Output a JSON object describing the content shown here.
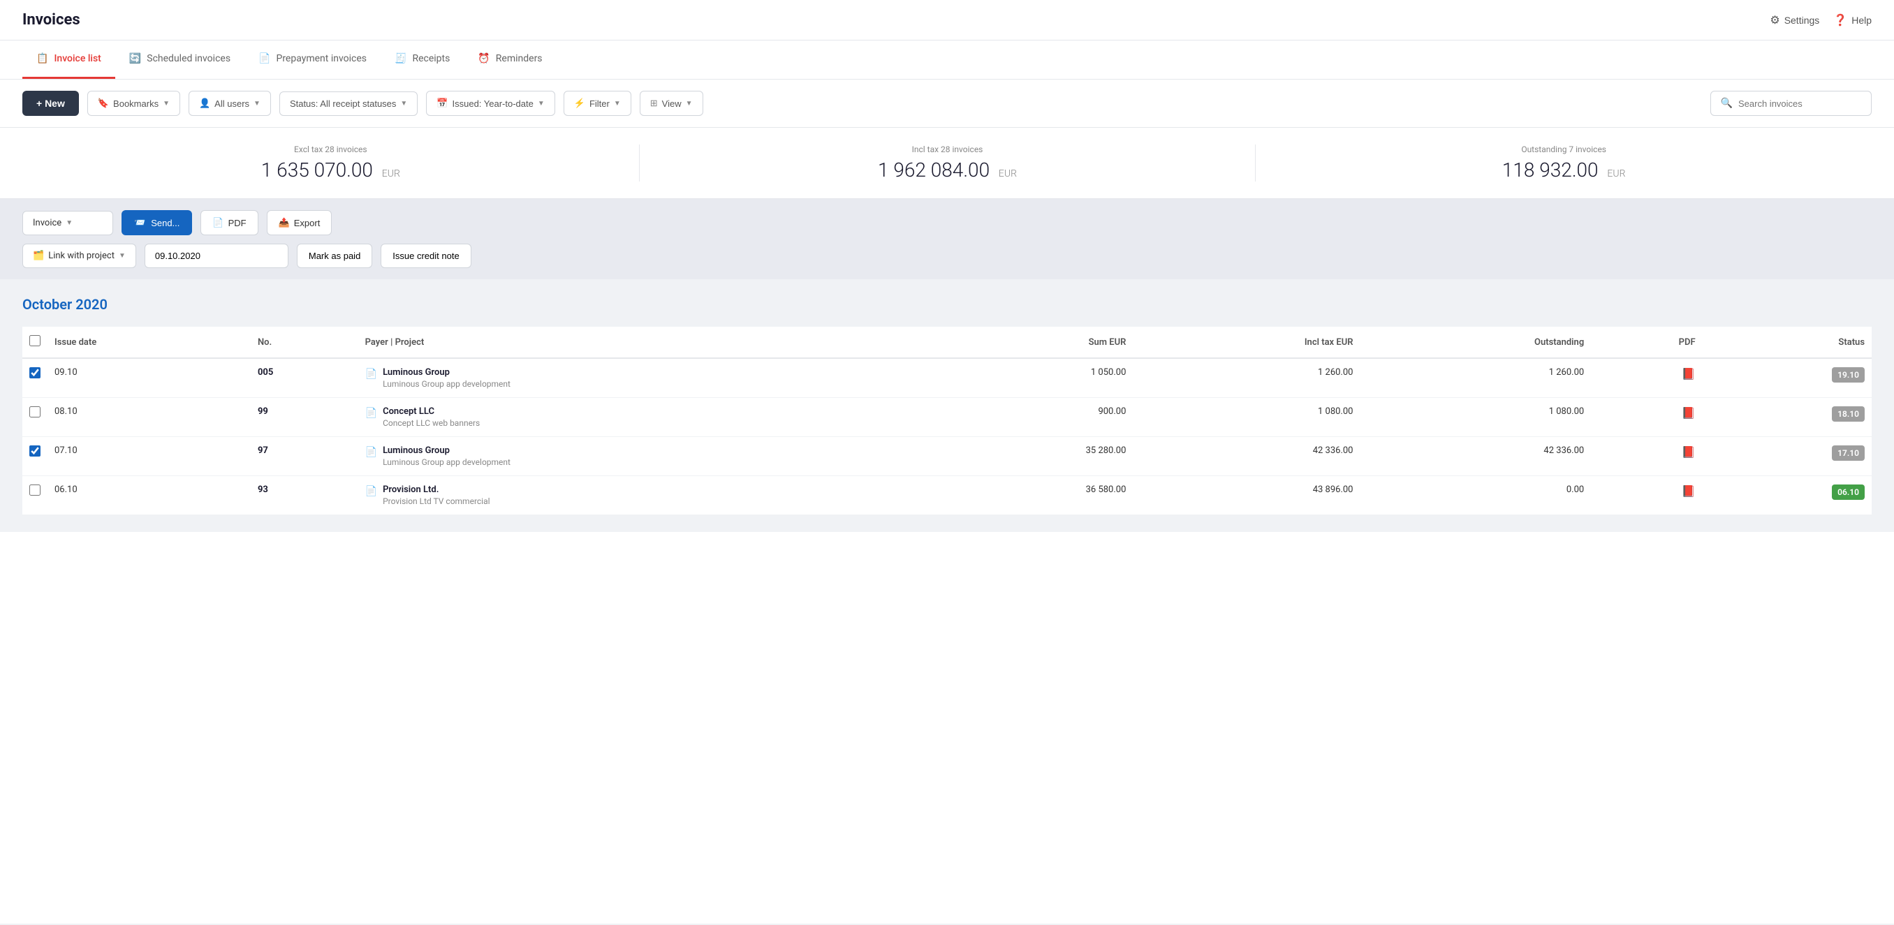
{
  "app": {
    "title": "Invoices",
    "settings_label": "Settings",
    "help_label": "Help"
  },
  "tabs": [
    {
      "id": "invoice-list",
      "label": "Invoice list",
      "active": true,
      "icon": "📋"
    },
    {
      "id": "scheduled-invoices",
      "label": "Scheduled invoices",
      "active": false,
      "icon": "🔄"
    },
    {
      "id": "prepayment-invoices",
      "label": "Prepayment invoices",
      "active": false,
      "icon": "📄"
    },
    {
      "id": "receipts",
      "label": "Receipts",
      "active": false,
      "icon": "🧾"
    },
    {
      "id": "reminders",
      "label": "Reminders",
      "active": false,
      "icon": "⏰"
    }
  ],
  "toolbar": {
    "new_label": "+ New",
    "bookmarks_label": "Bookmarks",
    "all_users_label": "All users",
    "status_label": "Status: All receipt statuses",
    "issued_label": "Issued: Year-to-date",
    "filter_label": "Filter",
    "view_label": "View",
    "search_placeholder": "Search invoices"
  },
  "summary": {
    "excl_tax_label": "Excl tax 28 invoices",
    "excl_tax_value": "1 635 070.00",
    "excl_tax_currency": "EUR",
    "incl_tax_label": "Incl tax 28 invoices",
    "incl_tax_value": "1 962 084.00",
    "incl_tax_currency": "EUR",
    "outstanding_label": "Outstanding 7 invoices",
    "outstanding_value": "118 932.00",
    "outstanding_currency": "EUR"
  },
  "action_bar": {
    "invoice_type": "Invoice",
    "send_label": "Send...",
    "pdf_label": "PDF",
    "export_label": "Export",
    "link_with_project_label": "Link with project",
    "date_value": "09.10.2020",
    "mark_as_paid_label": "Mark as paid",
    "issue_credit_note_label": "Issue credit note"
  },
  "month_header": "October 2020",
  "table": {
    "headers": {
      "issue_date": "Issue date",
      "no": "No.",
      "payer_project": "Payer | Project",
      "sum_eur": "Sum EUR",
      "incl_tax_eur": "Incl tax EUR",
      "outstanding": "Outstanding",
      "pdf": "PDF",
      "status": "Status"
    },
    "rows": [
      {
        "id": "row1",
        "checked": true,
        "issue_date": "09.10",
        "no": "005",
        "payer": "Luminous Group",
        "project": "Luminous Group app development",
        "sum_eur": "1 050.00",
        "incl_tax_eur": "1 260.00",
        "outstanding": "1 260.00",
        "status_label": "19.10",
        "status_color": "gray"
      },
      {
        "id": "row2",
        "checked": false,
        "issue_date": "08.10",
        "no": "99",
        "payer": "Concept LLC",
        "project": "Concept LLC web banners",
        "sum_eur": "900.00",
        "incl_tax_eur": "1 080.00",
        "outstanding": "1 080.00",
        "status_label": "18.10",
        "status_color": "gray"
      },
      {
        "id": "row3",
        "checked": true,
        "issue_date": "07.10",
        "no": "97",
        "payer": "Luminous Group",
        "project": "Luminous Group app development",
        "sum_eur": "35 280.00",
        "incl_tax_eur": "42 336.00",
        "outstanding": "42 336.00",
        "status_label": "17.10",
        "status_color": "gray"
      },
      {
        "id": "row4",
        "checked": false,
        "issue_date": "06.10",
        "no": "93",
        "payer": "Provision Ltd.",
        "project": "Provision Ltd TV commercial",
        "sum_eur": "36 580.00",
        "incl_tax_eur": "43 896.00",
        "outstanding": "0.00",
        "status_label": "06.10",
        "status_color": "green"
      }
    ]
  }
}
